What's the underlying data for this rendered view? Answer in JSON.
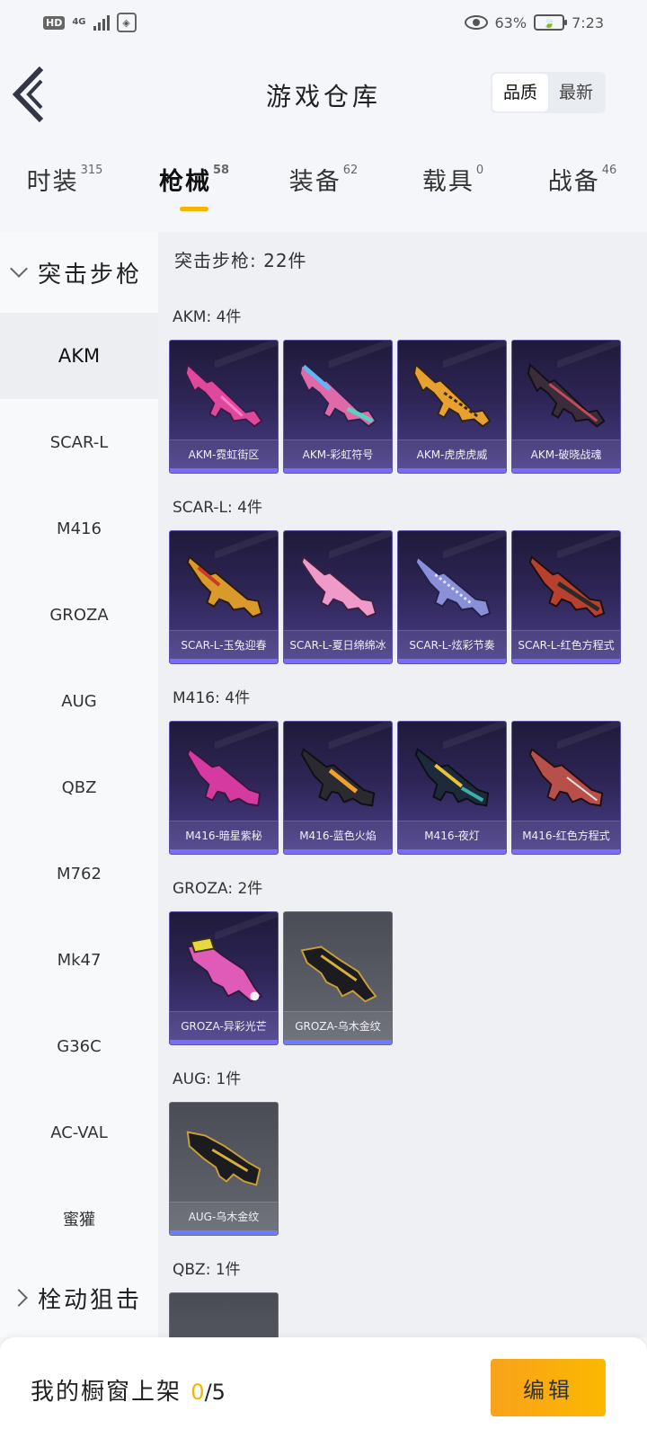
{
  "status_bar": {
    "hd": "HD",
    "network": "4G",
    "battery": "63%",
    "time": "7:23"
  },
  "header": {
    "title": "游戏仓库",
    "sort": [
      "品质",
      "最新"
    ]
  },
  "tabs": [
    {
      "label": "时装",
      "count": "315"
    },
    {
      "label": "枪械",
      "count": "58"
    },
    {
      "label": "装备",
      "count": "62"
    },
    {
      "label": "载具",
      "count": "0"
    },
    {
      "label": "战备",
      "count": "46"
    }
  ],
  "sidebar": {
    "group_open": "突击步枪",
    "items": [
      "AKM",
      "SCAR-L",
      "M416",
      "GROZA",
      "AUG",
      "QBZ",
      "M762",
      "Mk47",
      "G36C",
      "AC-VAL",
      "蜜獾"
    ],
    "group_next": "栓动狙击"
  },
  "content": {
    "title": "突击步枪: 22件",
    "groups": [
      {
        "title": "AKM: 4件",
        "items": [
          "AKM-霓虹街区",
          "AKM-彩虹符号",
          "AKM-虎虎虎威",
          "AKM-破晓战魂"
        ]
      },
      {
        "title": "SCAR-L: 4件",
        "items": [
          "SCAR-L-玉兔迎春",
          "SCAR-L-夏日绵绵冰",
          "SCAR-L-炫彩节奏",
          "SCAR-L-红色方程式"
        ]
      },
      {
        "title": "M416: 4件",
        "items": [
          "M416-暗星紫秘",
          "M416-蓝色火焰",
          "M416-夜灯",
          "M416-红色方程式"
        ]
      },
      {
        "title": "GROZA: 2件",
        "items": [
          "GROZA-异彩光芒",
          "GROZA-乌木金纹"
        ]
      },
      {
        "title": "AUG: 1件",
        "items": [
          "AUG-乌木金纹"
        ]
      },
      {
        "title": "QBZ: 1件",
        "items": []
      }
    ]
  },
  "bottom": {
    "label": "我的橱窗上架",
    "current": "0",
    "total": "/5",
    "edit": "编辑"
  },
  "colors": {
    "accent": "#f5b400",
    "epic_card": "#2e2556",
    "plain_card": "#5a5c66"
  }
}
